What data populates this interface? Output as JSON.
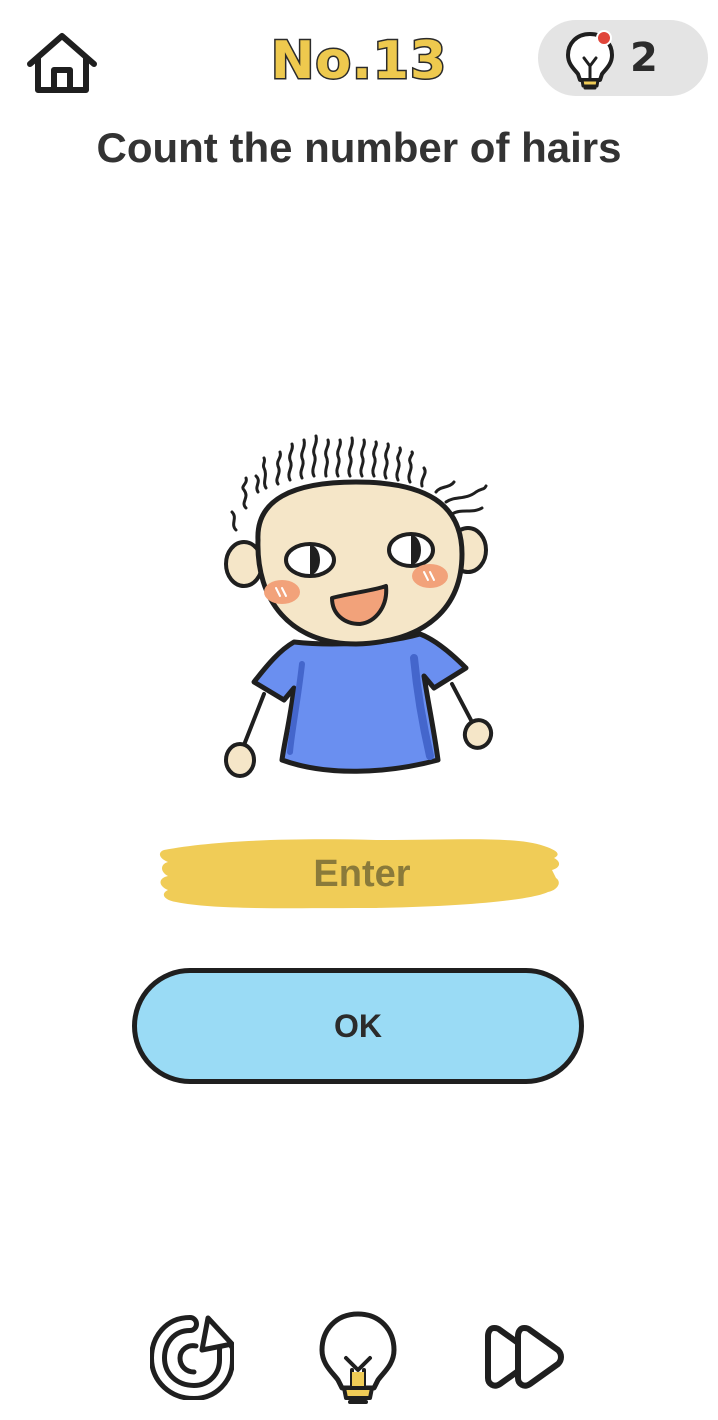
{
  "header": {
    "level_title": "No.13",
    "hint_count": "2"
  },
  "question": "Count the number of hairs",
  "answer": {
    "placeholder": "Enter",
    "value": ""
  },
  "ok_label": "OK",
  "colors": {
    "level_title_fill": "#eec94e",
    "answer_bar": "#f0cc57",
    "ok_button": "#9adbf5",
    "shirt": "#6a8ff0",
    "skin": "#f5e6c8",
    "hint_pill": "#e4e4e4"
  },
  "icons": {
    "home": "home-icon",
    "hint_badge": "lightbulb-icon",
    "restart": "restart-icon",
    "hint": "lightbulb-icon",
    "skip": "fast-forward-icon"
  }
}
